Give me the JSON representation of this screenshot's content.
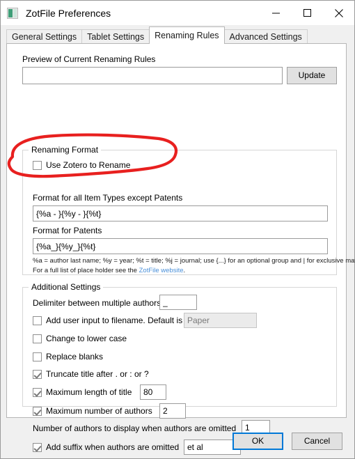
{
  "window": {
    "title": "ZotFile Preferences",
    "icon": "app-icon",
    "controls": [
      {
        "name": "minimize",
        "glyph": "minimize-icon"
      },
      {
        "name": "maximize",
        "glyph": "maximize-icon"
      },
      {
        "name": "close",
        "glyph": "close-icon"
      }
    ]
  },
  "tabs": [
    {
      "label": "General Settings",
      "selected": false
    },
    {
      "label": "Tablet Settings",
      "selected": false
    },
    {
      "label": "Renaming Rules",
      "selected": true
    },
    {
      "label": "Advanced Settings",
      "selected": false
    }
  ],
  "preview": {
    "label": "Preview of Current Renaming Rules",
    "value": "",
    "placeholder": "",
    "update_label": "Update"
  },
  "renaming_format": {
    "title": "Renaming Format",
    "use_zotero": {
      "label": "Use Zotero to Rename",
      "checked": false
    },
    "format_all_label": "Format for all Item Types except Patents",
    "format_all_value": "{%a - }{%y - }{%t}",
    "format_patents_label": "Format for Patents",
    "format_patents_value": "{%a_}{%y_}{%t}",
    "hint_line1": "%a = author last name; %y = year; %t = title; %j = journal; use {...} for an optional group and | for exclusive matches",
    "hint_line2_prefix": "For a full list of place holder see the ",
    "hint_link": "ZotFile website",
    "hint_line2_suffix": "."
  },
  "additional_settings": {
    "title": "Additional Settings",
    "delimiter_label": "Delimiter between multiple authors",
    "delimiter_value": "_",
    "user_input": {
      "label": "Add user input to filename. Default is",
      "checked": false,
      "value": "Paper",
      "disabled": true
    },
    "lower_case": {
      "label": "Change to lower case",
      "checked": false
    },
    "replace_blanks": {
      "label": "Replace blanks",
      "checked": false
    },
    "truncate_title": {
      "label": "Truncate title after . or : or ?",
      "checked": true
    },
    "max_title_length": {
      "label": "Maximum length of title",
      "checked": true,
      "value": "80"
    },
    "max_authors": {
      "label": "Maximum number of authors",
      "checked": true,
      "value": "2"
    },
    "authors_displayed_label": "Number of authors to display when authors are omitted",
    "authors_displayed_value": "1",
    "suffix_omitted": {
      "label": "Add suffix when authors are omitted",
      "checked": true,
      "value": "et al"
    }
  },
  "footer": {
    "ok_label": "OK",
    "cancel_label": "Cancel"
  },
  "annotation": {
    "shape": "hand-drawn-red-ellipse",
    "color": "#e8201f"
  }
}
